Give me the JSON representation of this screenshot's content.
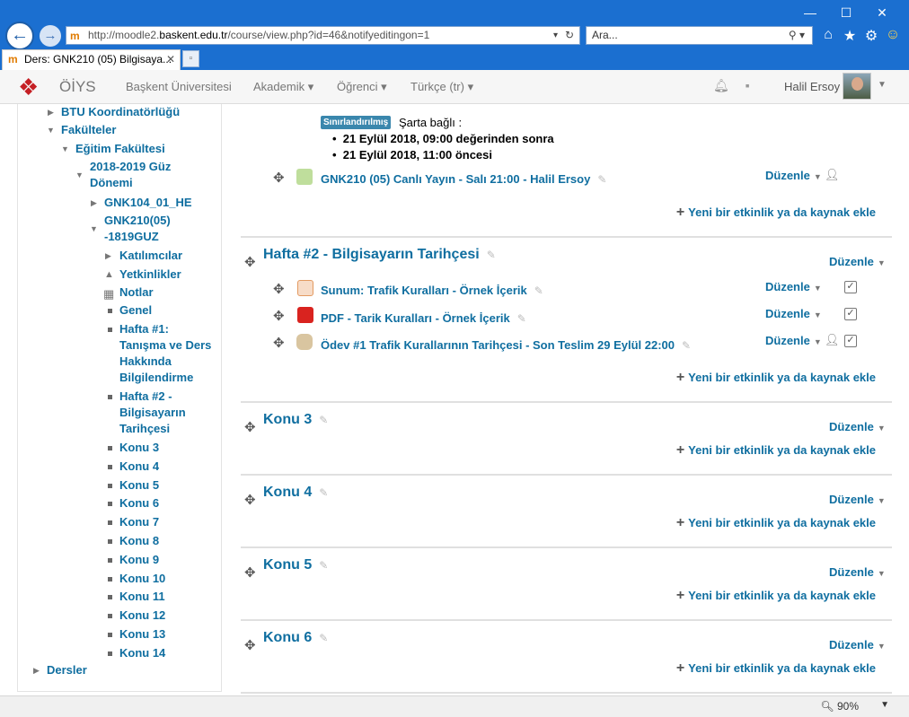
{
  "browser": {
    "url_prefix": "http://moodle2.",
    "url_host": "baskent.edu.tr",
    "url_path": "/course/view.php?id=46&notifyeditingon=1",
    "search_placeholder": "Ara...",
    "tab_title": "Ders: GNK210 (05) Bilgisaya...",
    "zoom": "90%"
  },
  "nav": {
    "brand": "ÖİYS",
    "items": [
      "Başkent Üniversitesi",
      "Akademik",
      "Öğrenci",
      "Türkçe (tr)"
    ],
    "user": "Halil Ersoy"
  },
  "tree": {
    "btu": "BTU Koordinatörlüğü",
    "fakulteler": "Fakülteler",
    "egitim": "Eğitim Fakültesi",
    "term1": "2018-2019 Güz",
    "term2": "Dönemi",
    "gnk104": "GNK104_01_HE",
    "gnk210a": "GNK210(05)",
    "gnk210b": "-1819GUZ",
    "katilimcilar": "Katılımcılar",
    "yetkinlikler": "Yetkinlikler",
    "notlar": "Notlar",
    "genel": "Genel",
    "h1a": "Hafta #1:",
    "h1b": "Tanışma ve Ders",
    "h1c": "Hakkında",
    "h1d": "Bilgilendirme",
    "h2a": "Hafta #2 -",
    "h2b": "Bilgisayarın",
    "h2c": "Tarihçesi",
    "konular": [
      "Konu 3",
      "Konu 4",
      "Konu 5",
      "Konu 6",
      "Konu 7",
      "Konu 8",
      "Konu 9",
      "Konu 10",
      "Konu 11",
      "Konu 12",
      "Konu 13",
      "Konu 14"
    ],
    "dersler": "Dersler"
  },
  "main": {
    "restricted_badge": "Sınırlandırılmış",
    "cond_title": "Şarta bağlı :",
    "cond1": "21 Eylül 2018, 09:00 değerinden sonra",
    "cond2": "21 Eylül 2018, 11:00 öncesi",
    "live": "GNK210 (05) Canlı Yayın - Salı 21:00 - Halil Ersoy",
    "edit": "Düzenle",
    "add": "Yeni bir etkinlik ya da kaynak ekle",
    "week2": "Hafta #2 - Bilgisayarın Tarihçesi",
    "act1": "Sunum: Trafik Kuralları - Örnek İçerik",
    "act2": "PDF - Tarik Kuralları - Örnek İçerik",
    "act3": "Ödev #1 Trafik Kurallarının Tarihçesi - Son Teslim 29 Eylül 22:00",
    "konu3": "Konu 3",
    "konu4": "Konu 4",
    "konu5": "Konu 5",
    "konu6": "Konu 6"
  }
}
